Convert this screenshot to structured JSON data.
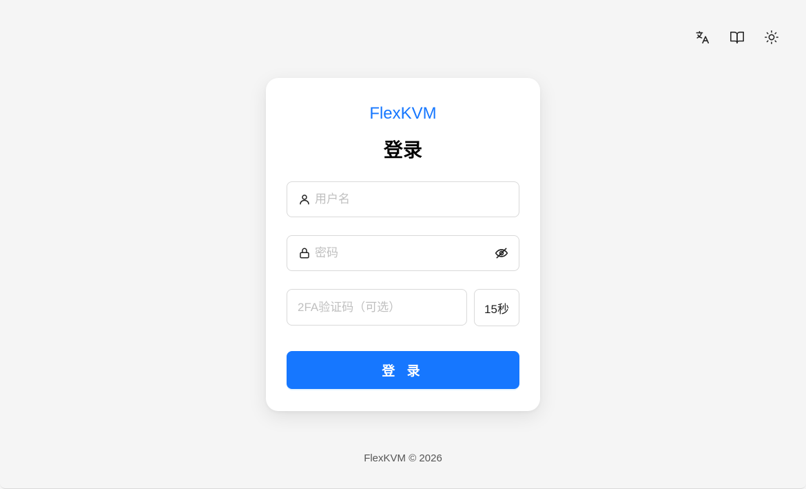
{
  "topbar": {
    "icons": [
      "translate-icon",
      "book-icon",
      "sun-icon"
    ]
  },
  "card": {
    "brand": "FlexKVM",
    "title": "登录",
    "username": {
      "placeholder": "用户名",
      "value": ""
    },
    "password": {
      "placeholder": "密码",
      "value": ""
    },
    "twofa": {
      "placeholder": "2FA验证码（可选）",
      "value": ""
    },
    "timer_label": "15秒",
    "login_label": "登 录"
  },
  "footer": {
    "text": "FlexKVM © 2026"
  },
  "colors": {
    "accent": "#1677ff",
    "background": "#f5f5f5",
    "card": "#ffffff"
  }
}
